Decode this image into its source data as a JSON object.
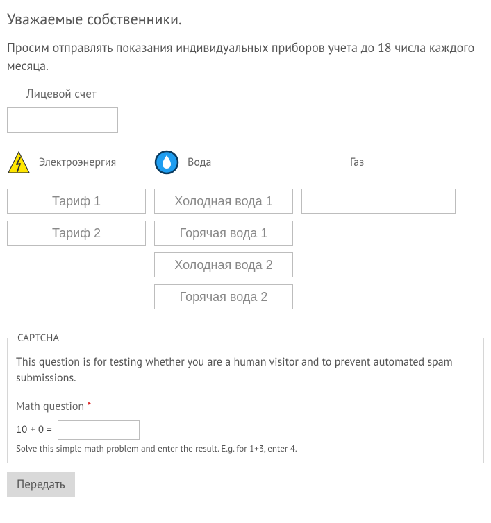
{
  "title": "Уважаемые собственники.",
  "intro": "Просим отправлять показания индивидуальных приборов учета до 18 числа каждого месяца.",
  "account_label": "Лицевой счет",
  "columns": {
    "electricity": {
      "label": "Электроэнергия",
      "inputs": [
        "Тариф 1",
        "Тариф 2"
      ]
    },
    "water": {
      "label": "Вода",
      "inputs": [
        "Холодная вода 1",
        "Горячая вода 1",
        "Холодная вода 2",
        "Горячая вода 2"
      ]
    },
    "gas": {
      "label": "Газ",
      "inputs": [
        ""
      ]
    }
  },
  "captcha": {
    "legend": "CAPTCHA",
    "description": "This question is for testing whether you are a human visitor and to prevent automated spam submissions.",
    "math_label": "Math question",
    "required_mark": "*",
    "math_question": "10 + 0 =",
    "hint": "Solve this simple math problem and enter the result. E.g. for 1+3, enter 4."
  },
  "submit_label": "Передать"
}
